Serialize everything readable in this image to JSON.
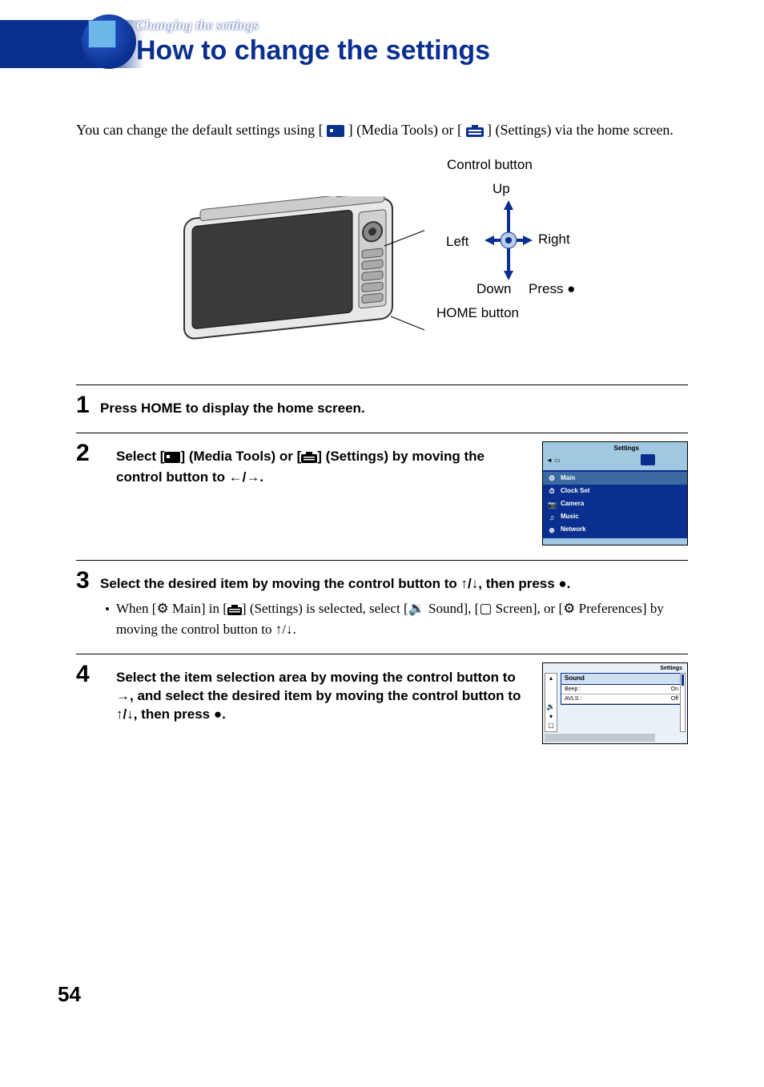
{
  "header": {
    "breadcrumb": "Changing the settings",
    "title": "How to change the settings"
  },
  "intro": {
    "line1a": "You can change the default settings using [",
    "line1b": "] (Media Tools) or [",
    "line1c": "] (Settings) via the home screen."
  },
  "diagram": {
    "control_title": "Control button",
    "up": "Up",
    "left": "Left",
    "right": "Right",
    "down": "Down",
    "press": "Press ●",
    "home": "HOME button"
  },
  "steps": {
    "s1": {
      "num": "1",
      "text": "Press HOME to display the home screen."
    },
    "s2": {
      "num": "2",
      "t1": "Select [",
      "t2": "] (Media Tools) or [",
      "t3": "] (Settings) by moving the control button to ←/→."
    },
    "s3": {
      "num": "3",
      "text": "Select the desired item by moving the control button to ↑/↓, then press ●.",
      "sub_a": "When [",
      "sub_b": " Main] in [",
      "sub_c": "] (Settings) is selected, select [",
      "sub_d": " Sound], [",
      "sub_e": " Screen], or [",
      "sub_f": " Preferences] by moving the control button to ↑/↓."
    },
    "s4": {
      "num": "4",
      "text": "Select the item selection area by moving the control button to →, and select the desired item by moving the control button to ↑/↓, then press ●."
    }
  },
  "shot1": {
    "title": "Settings",
    "rows": [
      "Main",
      "Clock Set",
      "Camera",
      "Music",
      "Network"
    ],
    "icons": [
      "⚙",
      "⏱",
      "📷",
      "♫",
      "⊕"
    ]
  },
  "shot2": {
    "title": "Settings",
    "panel": "Sound",
    "r1k": "Beep :",
    "r1v": "On",
    "r2k": "AVLS :",
    "r2v": "Off"
  },
  "page_num": "54"
}
